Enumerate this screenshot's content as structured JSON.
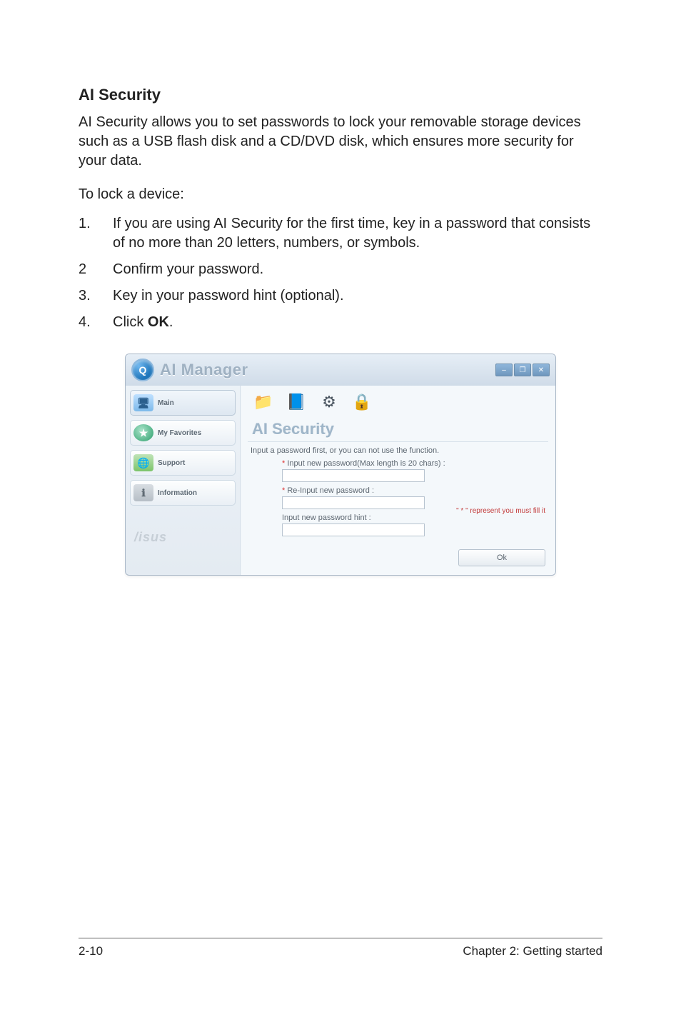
{
  "section": {
    "title": "AI Security",
    "intro": "AI Security allows you to set passwords to lock your removable storage devices such as a USB flash disk and a CD/DVD disk, which ensures more security for your data.",
    "lockIntro": "To lock a device:",
    "steps": {
      "n1": "1.",
      "t1": "If you are using AI Security for the first time, key in a password that consists of no more than 20 letters, numbers, or symbols.",
      "n2": "2",
      "t2": "Confirm your password.",
      "n3": "3.",
      "t3": "Key in your password hint (optional).",
      "n4": "4.",
      "t4a": "Click ",
      "t4b": "OK",
      "t4c": "."
    }
  },
  "window": {
    "logoLetter": "Q",
    "title": "AI Manager",
    "min": "–",
    "max": "❐",
    "close": "✕",
    "sidebar": {
      "main": "Main",
      "fav": "My Favorites",
      "support": "Support",
      "info": "Information",
      "brand": "/isus"
    },
    "toolbar": {
      "i1": "📁",
      "i2": "📘",
      "i3": "⚙",
      "i4": "🔒"
    },
    "panel": {
      "title": "AI Security",
      "instr": "Input a password first, or you can not use the function.",
      "rowA": "Input new password(Max length is 20 chars) :",
      "rowB": "Re-Input new password :",
      "rowC": "Input new password hint :",
      "ast": "*",
      "req": "\" * \" represent you must fill it",
      "ok": "Ok"
    }
  },
  "footer": {
    "left": "2-10",
    "right": "Chapter 2: Getting started"
  }
}
